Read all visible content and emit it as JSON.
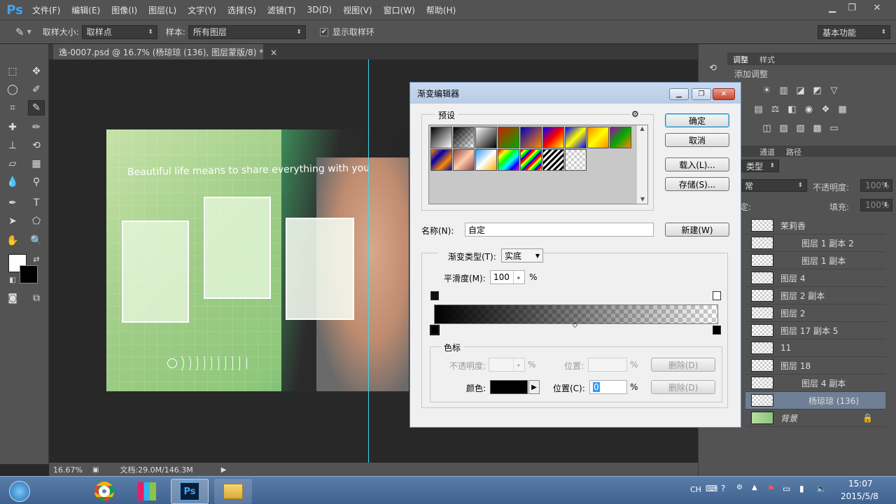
{
  "app": {
    "logo": "Ps"
  },
  "menu": [
    "文件(F)",
    "编辑(E)",
    "图像(I)",
    "图层(L)",
    "文字(Y)",
    "选择(S)",
    "滤镜(T)",
    "3D(D)",
    "视图(V)",
    "窗口(W)",
    "帮助(H)"
  ],
  "window_controls": {
    "minimize": "▁",
    "restore": "❐",
    "close": "✕"
  },
  "options": {
    "sample_size_label": "取样大小:",
    "sample_size_value": "取样点",
    "sample_label": "样本:",
    "sample_value": "所有图层",
    "show_ring_label": "显示取样环",
    "show_ring_checked": "✔",
    "workspace": "基本功能"
  },
  "document": {
    "tab_title": "逸-0007.psd @ 16.7% (杨琼琼 (136), 图层蒙版/8) *",
    "tab_close": "×",
    "canvas_text": "Beautiful life means to share everything with you",
    "zoom": "16.67%",
    "doc_size": "文档:29.0M/146.3M"
  },
  "dialog": {
    "title": "渐变编辑器",
    "presets_label": "预设",
    "ok": "确定",
    "cancel": "取消",
    "load": "载入(L)...",
    "save": "存储(S)...",
    "name_label": "名称(N):",
    "name_value": "自定",
    "new": "新建(W)",
    "gradient_type_label": "渐变类型(T):",
    "gradient_type_value": "实底",
    "smoothness_label": "平滑度(M):",
    "smoothness_value": "100",
    "percent": "%",
    "stops_label": "色标",
    "opacity_label": "不透明度:",
    "location_label": "位置:",
    "delete": "删除(D)",
    "color_label": "颜色:",
    "location2_label": "位置(C):",
    "location2_value": "0",
    "color_value": "#000000"
  },
  "panels": {
    "tab_adjust": "调整",
    "tab_style": "样式",
    "add_adjust": "添加调整",
    "tab_channels": "通道",
    "tab_paths": "路径",
    "kind_label": "类型",
    "blend_mode": "常",
    "opacity_label": "不透明度:",
    "opacity_value": "100%",
    "lock_label": "定:",
    "fill_label": "填充:",
    "fill_value": "100%",
    "layers": [
      {
        "name": "茉莉香"
      },
      {
        "name": "图层 1 副本 2"
      },
      {
        "name": "图层 1 副本"
      },
      {
        "name": "图层 4"
      },
      {
        "name": "图层 2 副本"
      },
      {
        "name": "图层 2"
      },
      {
        "name": "图层 17 副本 5"
      },
      {
        "name": "11"
      },
      {
        "name": "图层 18"
      },
      {
        "name": "图层 4 副本"
      },
      {
        "name": "杨琼琼 (136)"
      },
      {
        "name": "背景"
      }
    ]
  },
  "taskbar": {
    "lang": "CH",
    "time": "15:07",
    "date": "2015/5/8"
  }
}
